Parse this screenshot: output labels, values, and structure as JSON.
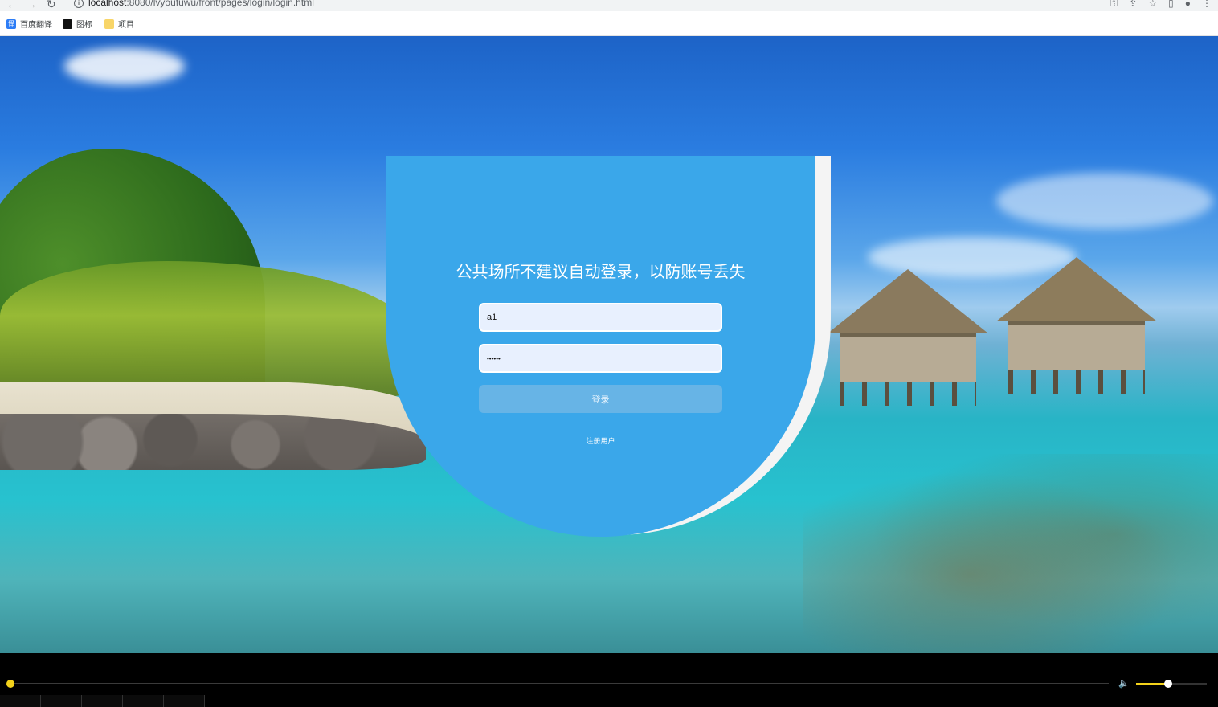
{
  "browser": {
    "url_host": "localhost",
    "url_path": ":8080/lvyoufuwu/front/pages/login/login.html",
    "bookmarks": [
      {
        "label": "百度翻译",
        "icon": "fanyi-icon"
      },
      {
        "label": "图标",
        "icon": "image-icon"
      },
      {
        "label": "项目",
        "icon": "folder-icon"
      }
    ]
  },
  "login": {
    "title": "公共场所不建议自动登录，以防账号丢失",
    "username_value": "a1",
    "password_value": "••••••",
    "login_label": "登录",
    "register_label": "注册用户"
  },
  "colors": {
    "card": "#3aa7ea",
    "login_button": "#67b4e6",
    "player_accent": "#f3d21b"
  },
  "player": {
    "progress": 0.0,
    "volume": 0.45
  }
}
